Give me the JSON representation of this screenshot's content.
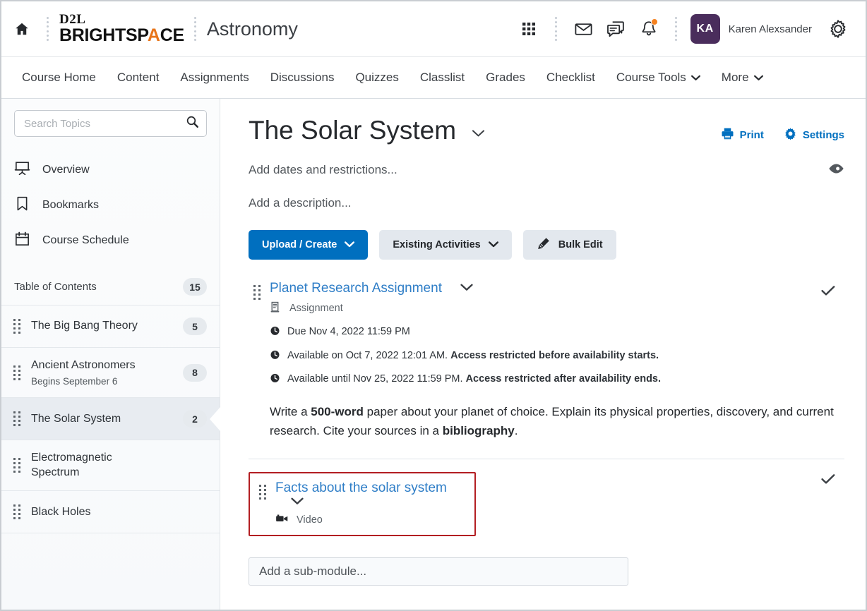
{
  "header": {
    "home_icon": "home-icon",
    "brand_line1": "D2L",
    "brand_line2_a": "BRIGHTSP",
    "brand_line2_accent": "A",
    "brand_line2_b": "CE",
    "course_title": "Astronomy",
    "icons": [
      "waffle-grid-icon",
      "envelope-icon",
      "chat-icon",
      "bell-icon"
    ],
    "notification_dot": true,
    "avatar_initials": "KA",
    "avatar_color": "#4a2d5c",
    "user_name": "Karen Alexsander",
    "settings_icon": "gear-icon"
  },
  "nav": {
    "items": [
      {
        "label": "Course Home",
        "has_caret": false
      },
      {
        "label": "Content",
        "has_caret": false
      },
      {
        "label": "Assignments",
        "has_caret": false
      },
      {
        "label": "Discussions",
        "has_caret": false
      },
      {
        "label": "Quizzes",
        "has_caret": false
      },
      {
        "label": "Classlist",
        "has_caret": false
      },
      {
        "label": "Grades",
        "has_caret": false
      },
      {
        "label": "Checklist",
        "has_caret": false
      },
      {
        "label": "Course Tools",
        "has_caret": true
      },
      {
        "label": "More",
        "has_caret": true
      }
    ]
  },
  "sidebar": {
    "search_placeholder": "Search Topics",
    "search_value": "",
    "links": [
      {
        "label": "Overview",
        "icon": "presentation-screen-icon"
      },
      {
        "label": "Bookmarks",
        "icon": "bookmark-icon"
      },
      {
        "label": "Course Schedule",
        "icon": "calendar-icon"
      }
    ],
    "toc_label": "Table of Contents",
    "toc_count": "15",
    "modules": [
      {
        "title": "The Big Bang Theory",
        "subtitle": "",
        "count": "5",
        "selected": false
      },
      {
        "title": "Ancient Astronomers",
        "subtitle": "Begins September 6",
        "count": "8",
        "selected": false
      },
      {
        "title": "The Solar System",
        "subtitle": "",
        "count": "2",
        "selected": true
      },
      {
        "title": "Electromagnetic Spectrum",
        "subtitle": "",
        "count": "",
        "selected": false
      },
      {
        "title": "Black Holes",
        "subtitle": "",
        "count": "",
        "selected": false
      }
    ]
  },
  "main": {
    "page_title": "The Solar System",
    "title_caret": "chevron-down-icon",
    "print_label": "Print",
    "settings_label": "Settings",
    "dates_placeholder": "Add dates and restrictions...",
    "description_placeholder": "Add a description...",
    "visibility_icon": "eye-icon",
    "buttons": [
      {
        "label": "Upload / Create",
        "style": "primary",
        "caret": true,
        "icon": ""
      },
      {
        "label": "Existing Activities",
        "style": "default",
        "caret": true,
        "icon": ""
      },
      {
        "label": "Bulk Edit",
        "style": "default",
        "caret": false,
        "icon": "pencil-icon"
      }
    ],
    "primary_color": "#006fbf",
    "link_color": "#2f7ec7",
    "highlight_color": "#b31e22",
    "items": [
      {
        "title": "Planet Research Assignment",
        "type_label": "Assignment",
        "type_icon": "assignment-document-icon",
        "completed_icon": "checkmark-icon",
        "highlighted": false,
        "meta": [
          {
            "icon": "clock-icon",
            "text": "Due Nov 4, 2022 11:59 PM",
            "bold": ""
          },
          {
            "icon": "clock-icon",
            "text": "Available on Oct 7, 2022 12:01 AM. ",
            "bold": "Access restricted before availability starts."
          },
          {
            "icon": "clock-icon",
            "text": "Available until Nov 25, 2022 11:59 PM. ",
            "bold": "Access restricted after availability ends."
          }
        ],
        "description_parts": [
          {
            "text": "Write a ",
            "bold": false
          },
          {
            "text": "500-word",
            "bold": true
          },
          {
            "text": " paper about your planet of choice. Explain its physical properties, discovery, and current research. Cite your sources in a ",
            "bold": false
          },
          {
            "text": "bibliography",
            "bold": true
          },
          {
            "text": ".",
            "bold": false
          }
        ]
      },
      {
        "title": "Facts about the solar system",
        "type_label": "Video",
        "type_icon": "video-camera-icon",
        "completed_icon": "checkmark-icon",
        "highlighted": true,
        "meta": [],
        "description_parts": []
      }
    ],
    "submodule_placeholder": "Add a sub-module..."
  }
}
